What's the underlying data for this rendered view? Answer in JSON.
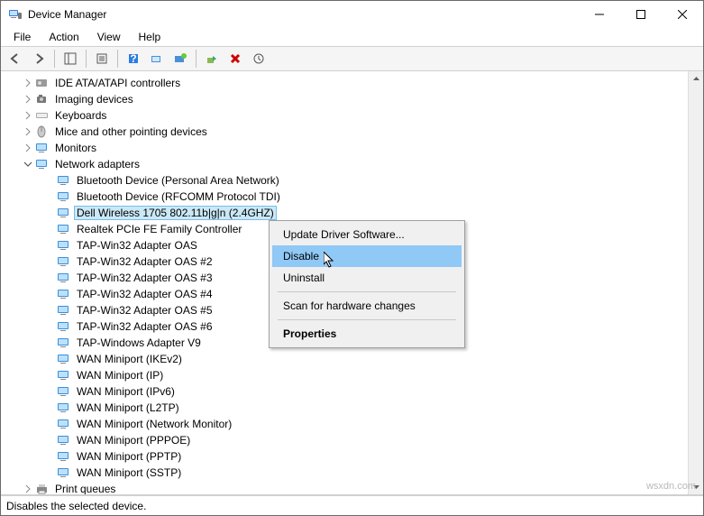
{
  "window": {
    "title": "Device Manager"
  },
  "menu": {
    "items": [
      "File",
      "Action",
      "View",
      "Help"
    ]
  },
  "status_bar": {
    "text": "Disables the selected device."
  },
  "watermark": "wsxdn.com",
  "tree": {
    "categories": [
      {
        "label": "IDE ATA/ATAPI controllers",
        "expanded": false,
        "icon": "storage"
      },
      {
        "label": "Imaging devices",
        "expanded": false,
        "icon": "camera"
      },
      {
        "label": "Keyboards",
        "expanded": false,
        "icon": "keyboard"
      },
      {
        "label": "Mice and other pointing devices",
        "expanded": false,
        "icon": "mouse"
      },
      {
        "label": "Monitors",
        "expanded": false,
        "icon": "monitor"
      },
      {
        "label": "Network adapters",
        "expanded": true,
        "icon": "network",
        "children": [
          {
            "label": "Bluetooth Device (Personal Area Network)",
            "selected": false
          },
          {
            "label": "Bluetooth Device (RFCOMM Protocol TDI)",
            "selected": false
          },
          {
            "label": "Dell Wireless 1705 802.11b|g|n (2.4GHZ)",
            "selected": true
          },
          {
            "label": "Realtek PCIe FE Family Controller",
            "selected": false
          },
          {
            "label": "TAP-Win32 Adapter OAS",
            "selected": false
          },
          {
            "label": "TAP-Win32 Adapter OAS #2",
            "selected": false
          },
          {
            "label": "TAP-Win32 Adapter OAS #3",
            "selected": false
          },
          {
            "label": "TAP-Win32 Adapter OAS #4",
            "selected": false
          },
          {
            "label": "TAP-Win32 Adapter OAS #5",
            "selected": false
          },
          {
            "label": "TAP-Win32 Adapter OAS #6",
            "selected": false
          },
          {
            "label": "TAP-Windows Adapter V9",
            "selected": false
          },
          {
            "label": "WAN Miniport (IKEv2)",
            "selected": false
          },
          {
            "label": "WAN Miniport (IP)",
            "selected": false
          },
          {
            "label": "WAN Miniport (IPv6)",
            "selected": false
          },
          {
            "label": "WAN Miniport (L2TP)",
            "selected": false
          },
          {
            "label": "WAN Miniport (Network Monitor)",
            "selected": false
          },
          {
            "label": "WAN Miniport (PPPOE)",
            "selected": false
          },
          {
            "label": "WAN Miniport (PPTP)",
            "selected": false
          },
          {
            "label": "WAN Miniport (SSTP)",
            "selected": false
          }
        ]
      },
      {
        "label": "Print queues",
        "expanded": false,
        "icon": "printer"
      }
    ]
  },
  "context_menu": {
    "items": [
      {
        "label": "Update Driver Software...",
        "type": "item"
      },
      {
        "label": "Disable",
        "type": "item",
        "highlight": true
      },
      {
        "label": "Uninstall",
        "type": "item"
      },
      {
        "type": "sep"
      },
      {
        "label": "Scan for hardware changes",
        "type": "item"
      },
      {
        "type": "sep"
      },
      {
        "label": "Properties",
        "type": "item",
        "bold": true
      }
    ]
  }
}
